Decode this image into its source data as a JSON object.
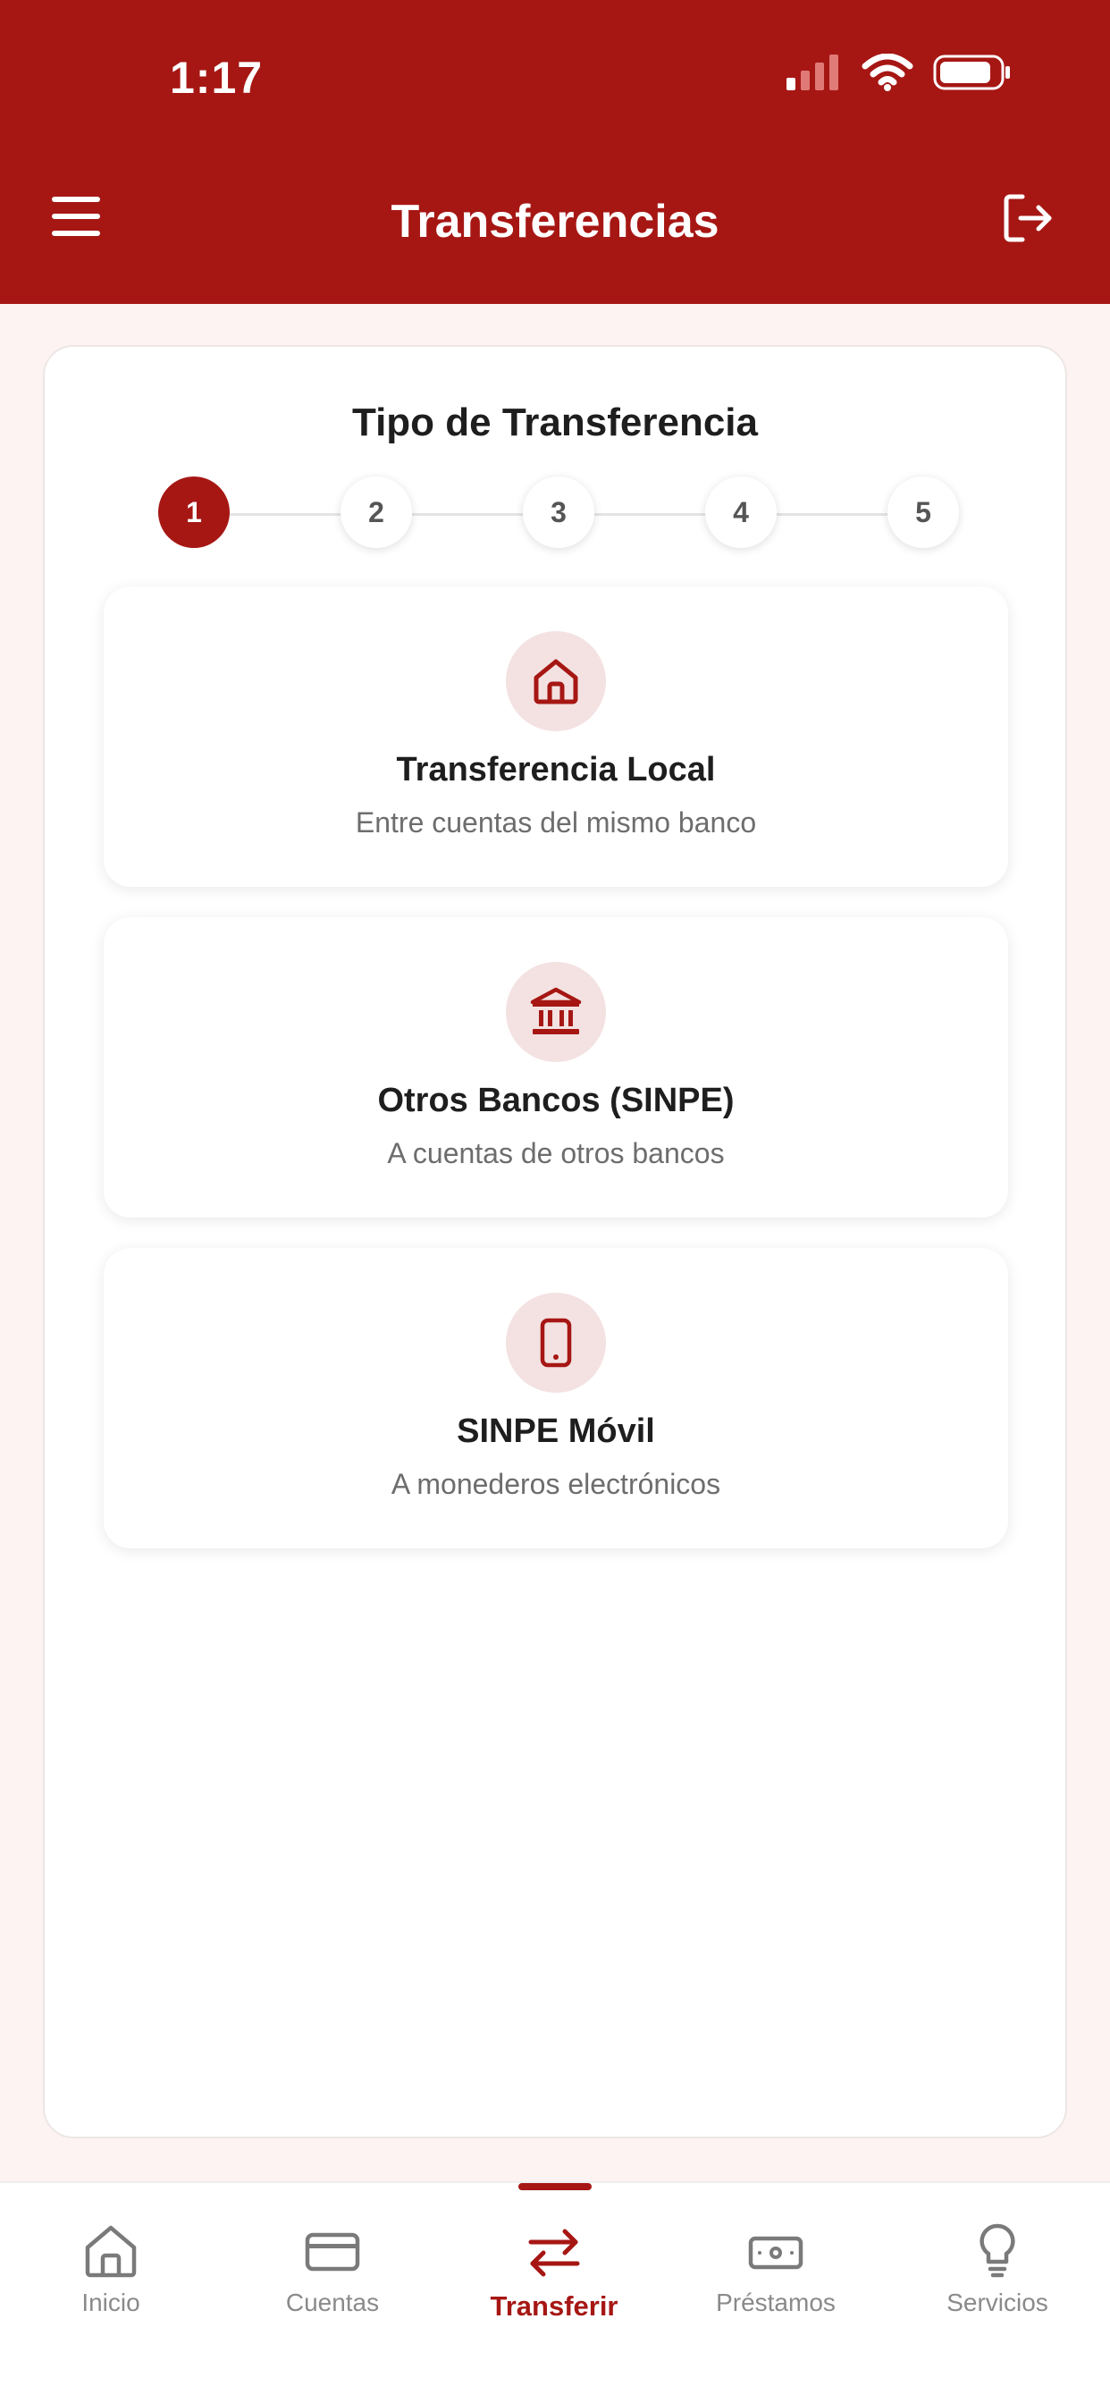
{
  "status_bar": {
    "time": "1:17"
  },
  "header": {
    "title": "Transferencias",
    "menu_icon": "hamburger-menu-icon",
    "logout_icon": "logout-icon"
  },
  "panel": {
    "title": "Tipo de Transferencia",
    "steps": [
      "1",
      "2",
      "3",
      "4",
      "5"
    ],
    "current_step": 1
  },
  "options": [
    {
      "icon": "home-icon",
      "title": "Transferencia Local",
      "subtitle": "Entre cuentas del mismo banco"
    },
    {
      "icon": "bank-icon",
      "title": "Otros Bancos (SINPE)",
      "subtitle": "A cuentas de otros bancos"
    },
    {
      "icon": "phone-icon",
      "title": "SINPE Móvil",
      "subtitle": "A monederos electrónicos"
    }
  ],
  "bottom_nav": {
    "items": [
      {
        "label": "Inicio",
        "icon": "home-icon"
      },
      {
        "label": "Cuentas",
        "icon": "card-icon"
      },
      {
        "label": "Transferir",
        "icon": "transfer-arrows-icon"
      },
      {
        "label": "Préstamos",
        "icon": "cash-icon"
      },
      {
        "label": "Servicios",
        "icon": "lightbulb-icon"
      }
    ],
    "active_index": 2
  },
  "colors": {
    "brand": "#a61714",
    "icon_bg": "#f3e2e1",
    "page_bg": "#fdf3f2"
  }
}
